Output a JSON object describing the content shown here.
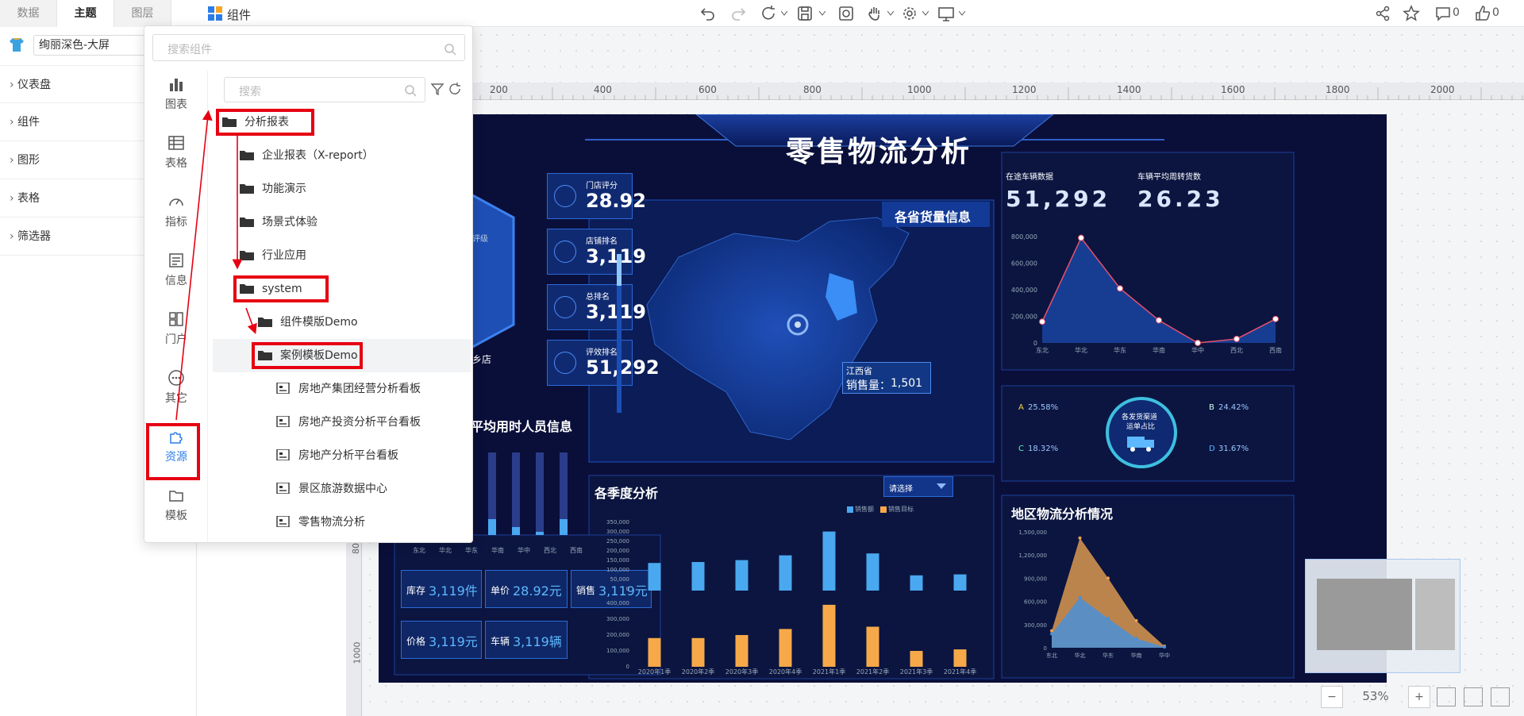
{
  "tabs": [
    "数据",
    "主题",
    "图层"
  ],
  "active_tab": "主题",
  "header": {
    "title": "组件",
    "comment_count": "0",
    "like_count": "0"
  },
  "theme_select": {
    "value": "绚丽深色-大屏"
  },
  "left_panel": {
    "items": [
      "仪表盘",
      "组件",
      "图形",
      "表格",
      "筛选器"
    ]
  },
  "ruler": {
    "h": [
      "200",
      "400",
      "600",
      "800",
      "1000",
      "1200",
      "1400",
      "1600",
      "1800",
      "2000"
    ],
    "v": [
      "800",
      "1000"
    ]
  },
  "zoom": {
    "value": "53%",
    "minus": "−",
    "plus": "+"
  },
  "popup": {
    "search_placeholder": "搜索组件",
    "inner_search_placeholder": "搜索",
    "rail": [
      "图表",
      "表格",
      "指标",
      "信息",
      "门户",
      "其它",
      "资源",
      "模板"
    ],
    "active_rail": "资源",
    "tree": [
      {
        "label": "分析报表",
        "type": "folder",
        "level": 0,
        "highlighted": true
      },
      {
        "label": "企业报表（X-report）",
        "type": "folder",
        "level": 1,
        "highlighted": false
      },
      {
        "label": "功能演示",
        "type": "folder",
        "level": 1,
        "highlighted": false
      },
      {
        "label": "场景式体验",
        "type": "folder",
        "level": 1,
        "highlighted": false
      },
      {
        "label": "行业应用",
        "type": "folder",
        "level": 1,
        "highlighted": false
      },
      {
        "label": "system",
        "type": "folder",
        "level": 1,
        "highlighted": true
      },
      {
        "label": "组件模版Demo",
        "type": "folder",
        "level": 2,
        "highlighted": false
      },
      {
        "label": "案例模板Demo",
        "type": "folder",
        "level": 2,
        "highlighted": true
      },
      {
        "label": "房地产集团经营分析看板",
        "type": "file",
        "level": 3,
        "highlighted": false
      },
      {
        "label": "房地产投资分析平台看板",
        "type": "file",
        "level": 3,
        "highlighted": false
      },
      {
        "label": "房地产分析平台看板",
        "type": "file",
        "level": 3,
        "highlighted": false
      },
      {
        "label": "景区旅游数据中心",
        "type": "file",
        "level": 3,
        "highlighted": false
      },
      {
        "label": "零售物流分析",
        "type": "file",
        "level": 3,
        "highlighted": false
      }
    ]
  },
  "dashboard": {
    "title": "零售物流分析",
    "kpis": [
      {
        "label": "门店评分",
        "value": "28.92"
      },
      {
        "label": "店铺排名",
        "value": "3,119"
      },
      {
        "label": "总排名",
        "value": "3,119"
      },
      {
        "label": "评效排名",
        "value": "51,292"
      }
    ],
    "hex_label": "评级",
    "store_label": "乡店",
    "staff_title": "平均用时人员信息",
    "staff_x": [
      "东北",
      "华北",
      "华东",
      "华南",
      "华中",
      "西北",
      "西南"
    ],
    "stats": [
      {
        "label": "库存",
        "value": "3,119件"
      },
      {
        "label": "单价",
        "value": "28.92元"
      },
      {
        "label": "销售",
        "value": "3,119元"
      },
      {
        "label": "价格",
        "value": "3,119元"
      },
      {
        "label": "车辆",
        "value": "3,119辆"
      }
    ],
    "map_title": "各省货量信息",
    "map_tooltip": {
      "province": "江西省",
      "label": "销售量：",
      "value": "1,501"
    },
    "vehicle_label": "在途车辆数据",
    "vehicle_value": "51,292",
    "avg_label": "车辆平均周转货数",
    "avg_value": "26.23",
    "line_y": [
      "800,000",
      "600,000",
      "400,000",
      "200,000",
      "0"
    ],
    "line_x": [
      "东北",
      "华北",
      "华东",
      "华南",
      "华中",
      "西北",
      "西南"
    ],
    "donut_center": [
      "各发货渠道",
      "运单占比"
    ],
    "donut_legend": [
      {
        "key": "A",
        "value": "25.58%"
      },
      {
        "key": "B",
        "value": "24.42%"
      },
      {
        "key": "C",
        "value": "18.32%"
      },
      {
        "key": "D",
        "value": "31.67%"
      }
    ],
    "season_title": "各季度分析",
    "season_select": "请选择",
    "season_legend": [
      "销售额",
      "销售目标"
    ],
    "season_y_top": [
      "350,000",
      "300,000",
      "250,000",
      "200,000",
      "150,000",
      "100,000",
      "50,000",
      "0"
    ],
    "season_y_bottom": [
      "400,000",
      "300,000",
      "200,000",
      "100,000",
      "0"
    ],
    "region_title": "地区物流分析情况",
    "region_y": [
      "1,500,000",
      "1,200,000",
      "900,000",
      "600,000",
      "300,000",
      "0"
    ],
    "region_x": [
      "东北",
      "华北",
      "华东",
      "华南",
      "华中"
    ]
  },
  "chart_data": [
    {
      "type": "bar",
      "title": "各季度分析",
      "categories": [
        "2020年1季",
        "2020年2季",
        "2020年3季",
        "2020年4季",
        "2021年1季",
        "2021年2季",
        "2021年3季",
        "2021年4季"
      ],
      "series": [
        {
          "name": "销售额",
          "values": [
            145000,
            150000,
            160000,
            185000,
            310000,
            195000,
            80000,
            85000
          ]
        },
        {
          "name": "销售目标",
          "values": [
            190000,
            190000,
            210000,
            250000,
            410000,
            265000,
            105000,
            115000
          ]
        }
      ],
      "colors": [
        "#4aa8f0",
        "#f7a94a"
      ]
    },
    {
      "type": "line",
      "title": "在途车辆数据",
      "categories": [
        "东北",
        "华北",
        "华东",
        "华南",
        "华中",
        "西北",
        "西南"
      ],
      "series": [
        {
          "values": [
            160000,
            790000,
            410000,
            170000,
            0,
            30000,
            180000
          ]
        }
      ],
      "ylim": [
        0,
        800000
      ],
      "colors": [
        "#e8506a"
      ]
    },
    {
      "type": "area",
      "title": "地区物流分析情况",
      "categories": [
        "东北",
        "华北",
        "华东",
        "华南",
        "华中"
      ],
      "series": [
        {
          "values": [
            220000,
            1420000,
            900000,
            350000,
            20000
          ]
        },
        {
          "values": [
            180000,
            650000,
            380000,
            120000,
            10000
          ]
        }
      ],
      "ylim": [
        0,
        1500000
      ],
      "colors": [
        "#e8a050",
        "#4a90d8"
      ]
    }
  ]
}
